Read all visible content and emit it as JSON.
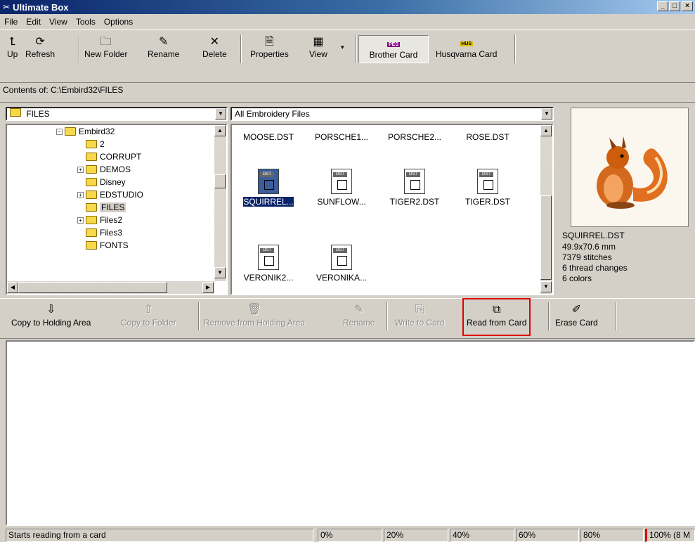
{
  "window": {
    "title": "Ultimate Box"
  },
  "menu": [
    "File",
    "Edit",
    "View",
    "Tools",
    "Options"
  ],
  "toolbar": {
    "up": "Up",
    "refresh": "Refresh",
    "new_folder": "New Folder",
    "rename": "Rename",
    "delete": "Delete",
    "properties": "Properties",
    "view": "View",
    "brother_card": "Brother Card",
    "husqvarna_card": "Husqvarna Card",
    "pes_tag": "PES",
    "hus_tag": "HUS"
  },
  "path": "Contents of: C:\\Embird32\\FILES",
  "folder_combo": "FILES",
  "filter_combo": "All Embroidery Files",
  "tree": [
    "Embird32",
    "2",
    "CORRUPT",
    "DEMOS",
    "Disney",
    "EDSTUDIO",
    "FILES",
    "Files2",
    "Files3",
    "FONTS"
  ],
  "files_top_row": [
    "MOOSE.DST",
    "PORSCHE1...",
    "PORSCHE2...",
    "ROSE.DST"
  ],
  "files": [
    {
      "name": "SQUIRREL..."
    },
    {
      "name": "SUNFLOW..."
    },
    {
      "name": "TIGER2.DST"
    },
    {
      "name": "TIGER.DST"
    },
    {
      "name": "VERONIK2..."
    },
    {
      "name": "VERONIKA..."
    }
  ],
  "doc_tag": "DST",
  "preview": {
    "file": "SQUIRREL.DST",
    "size": "49.9x70.6 mm",
    "stitches": "7379 stitches",
    "thread_changes": "6 thread changes",
    "colors": "6 colors"
  },
  "actions": {
    "copy_holding": "Copy to Holding Area",
    "copy_folder": "Copy to Folder",
    "remove_holding": "Remove from Holding Area",
    "rename": "Rename",
    "write_card": "Write to Card",
    "read_card": "Read from Card",
    "erase_card": "Erase Card"
  },
  "status": {
    "message": "Starts reading from a card",
    "ticks": [
      "0%",
      "20%",
      "40%",
      "60%",
      "80%",
      "100% (8 M"
    ]
  }
}
